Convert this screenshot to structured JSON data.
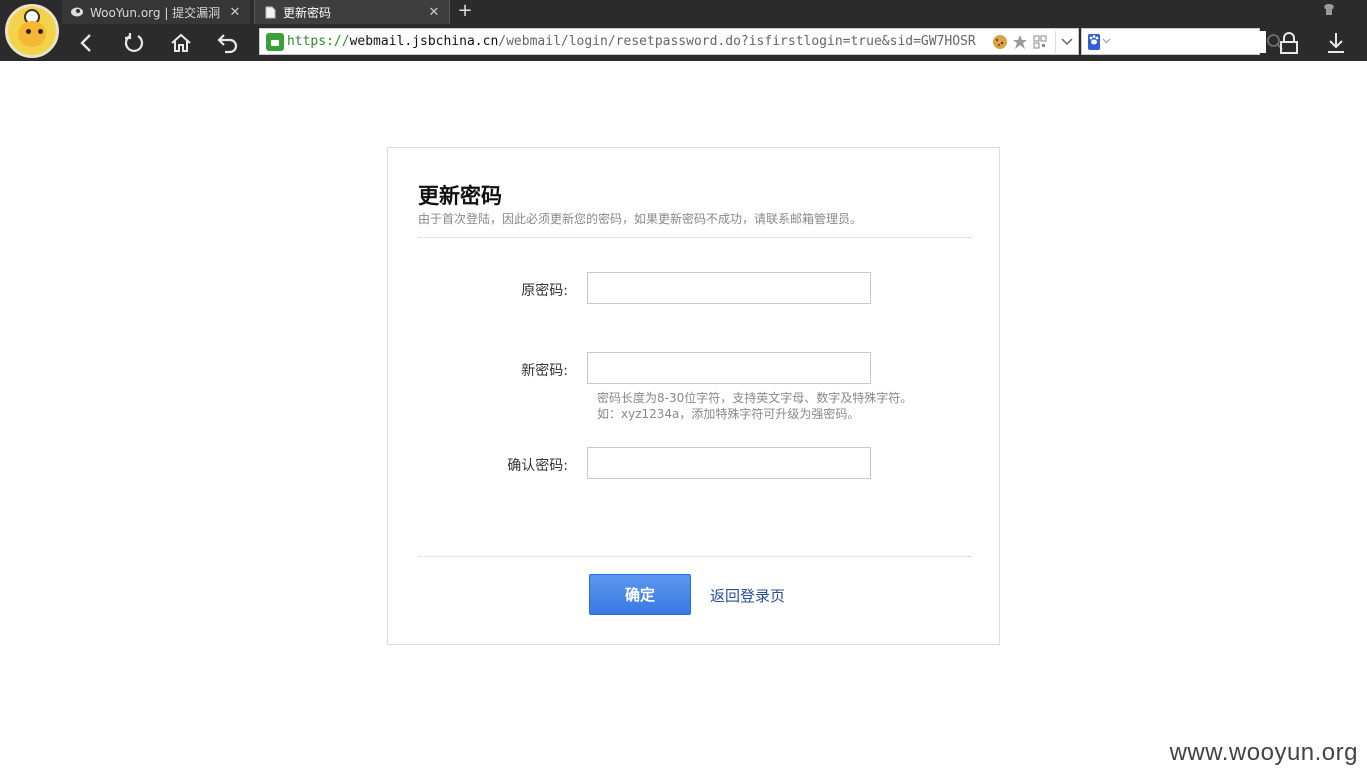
{
  "browser": {
    "tabs": [
      {
        "title": "WooYun.org | 提交漏洞",
        "active": false
      },
      {
        "title": "更新密码",
        "active": true
      }
    ],
    "url": {
      "scheme": "https://",
      "host": "webmail.jsbchina.cn",
      "path": "/webmail/login/resetpassword.do?isfirstlogin=true&sid=GW7HOSR"
    },
    "search": {
      "value": ""
    }
  },
  "form": {
    "title": "更新密码",
    "subtitle": "由于首次登陆，因此必须更新您的密码，如果更新密码不成功，请联系邮箱管理员。",
    "fields": [
      {
        "label": "原密码:",
        "value": ""
      },
      {
        "label": "新密码:",
        "value": ""
      },
      {
        "label": "确认密码:",
        "value": ""
      }
    ],
    "hint_line1": "密码长度为8-30位字符，支持英文字母、数字及特殊字符。",
    "hint_line2": "如：xyz1234a，添加特殊字符可升级为强密码。",
    "confirm_label": "确定",
    "back_label": "返回登录页"
  },
  "watermark": "www.wooyun.org",
  "colors": {
    "chrome_bg": "#2b2b2b",
    "button_blue": "#3a78e3",
    "link_blue": "#2a4f9a",
    "lock_green": "#3aa13a"
  }
}
